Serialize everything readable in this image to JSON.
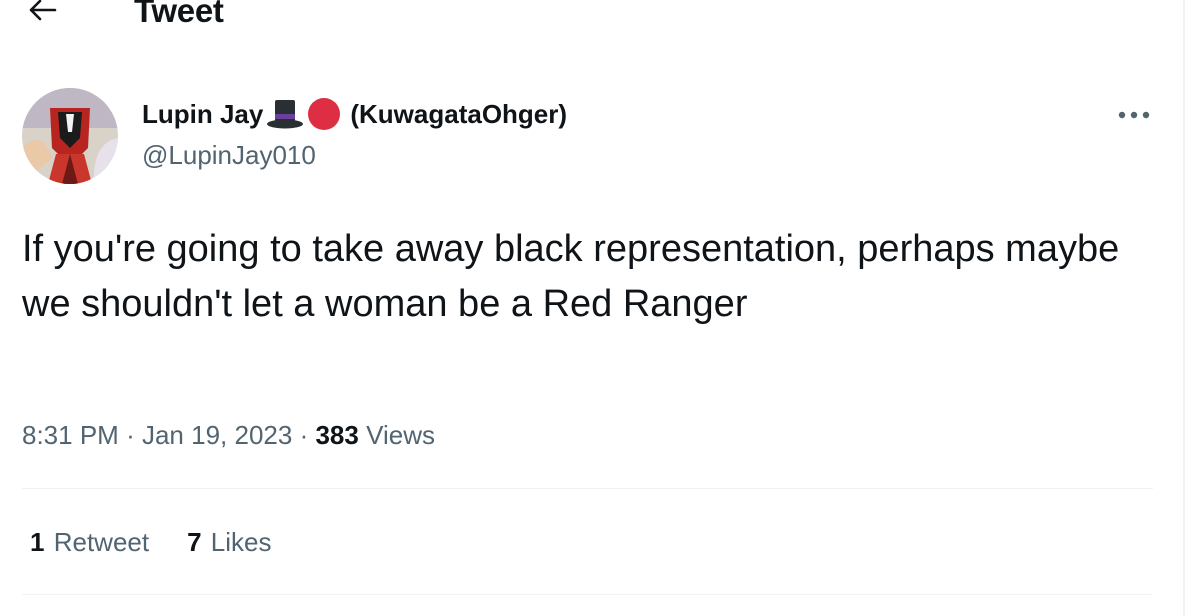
{
  "header": {
    "title": "Tweet",
    "back_icon": "arrow-left-icon"
  },
  "author": {
    "display_name": "Lupin Jay",
    "name_suffix": "(KuwagataOhger)",
    "handle": "@LupinJay010",
    "emoji": [
      "top-hat-emoji",
      "red-circle-emoji"
    ]
  },
  "tweet": {
    "text": "If you're going to take away black representation, perhaps maybe we shouldn't let a woman be a Red Ranger"
  },
  "meta": {
    "time": "8:31 PM",
    "separator": "·",
    "date": "Jan 19, 2023",
    "views_count": "383",
    "views_label": "Views"
  },
  "stats": {
    "retweets_count": "1",
    "retweets_label": "Retweet",
    "likes_count": "7",
    "likes_label": "Likes"
  },
  "colors": {
    "text_primary": "#0f1419",
    "text_secondary": "#536471",
    "divider": "#eff3f4",
    "red_circle": "#dd2e44",
    "top_hat_band": "#6b3fa0"
  }
}
